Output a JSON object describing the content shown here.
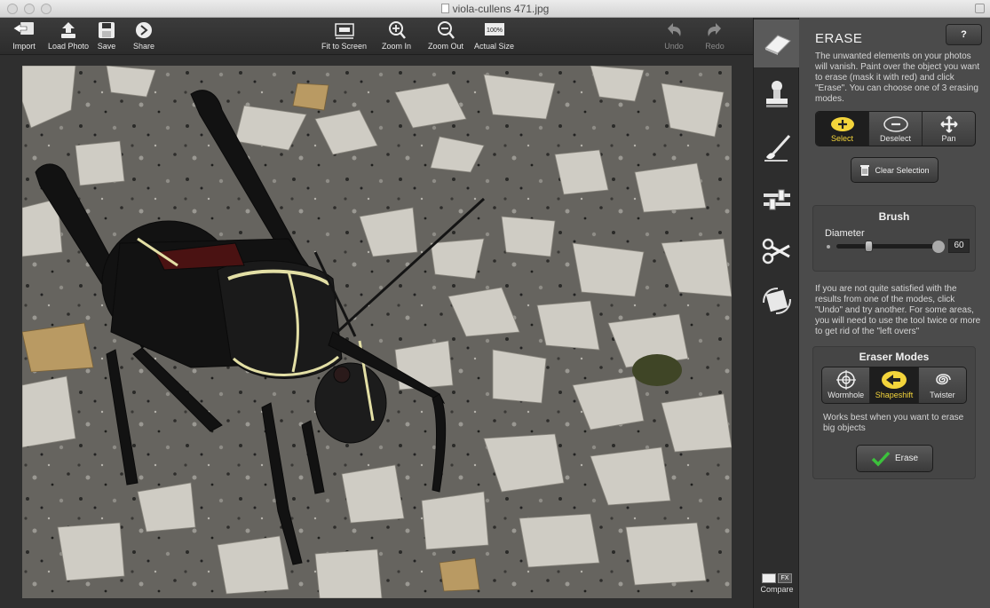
{
  "window": {
    "title": "viola-cullens 471.jpg"
  },
  "toolbar": {
    "import_label": "Import",
    "load_photo_label": "Load Photo",
    "save_label": "Save",
    "share_label": "Share",
    "fit_to_screen_label": "Fit to Screen",
    "zoom_in_label": "Zoom In",
    "zoom_out_label": "Zoom Out",
    "actual_size_label": "Actual Size",
    "actual_size_icon_text": "100%",
    "undo_label": "Undo",
    "redo_label": "Redo"
  },
  "rail": {
    "tools": [
      "eraser-icon",
      "stamp-icon",
      "brush-icon",
      "adjust-icon",
      "scissors-icon",
      "rotate-icon"
    ],
    "active_tool": "eraser-icon",
    "compare_label": "Compare",
    "compare_fx": "FX"
  },
  "panel": {
    "title": "ERASE",
    "help_label": "?",
    "description": "The unwanted elements on your photos will vanish. Paint over the object you want to erase (mask it with red) and click \"Erase\". You can choose one of 3 erasing modes.",
    "selection_modes": [
      {
        "label": "Select",
        "icon": "select-plus-icon",
        "active": true
      },
      {
        "label": "Deselect",
        "icon": "deselect-minus-icon",
        "active": false
      },
      {
        "label": "Pan",
        "icon": "pan-icon",
        "active": false
      }
    ],
    "clear_selection_label": "Clear Selection",
    "brush": {
      "title": "Brush",
      "diameter_label": "Diameter",
      "diameter_value": "60",
      "diameter_fraction": 0.3
    },
    "tip": "If you are not quite satisfied with the results from one of the modes, click \"Undo\" and try another. For some areas, you will need to use the tool twice or more to get rid of the \"left overs\"",
    "eraser_modes": {
      "title": "Eraser Modes",
      "items": [
        {
          "label": "Wormhole",
          "icon": "wormhole-icon",
          "active": false
        },
        {
          "label": "Shapeshift",
          "icon": "shapeshift-icon",
          "active": true
        },
        {
          "label": "Twister",
          "icon": "twister-icon",
          "active": false
        }
      ],
      "hint": "Works best when you want to erase big objects"
    },
    "erase_label": "Erase"
  },
  "colors": {
    "accent_yellow": "#f3d43b",
    "panel_bg": "#4b4b4b",
    "toolbar_bg": "#2c2c2c",
    "check_green": "#3cc13c"
  }
}
